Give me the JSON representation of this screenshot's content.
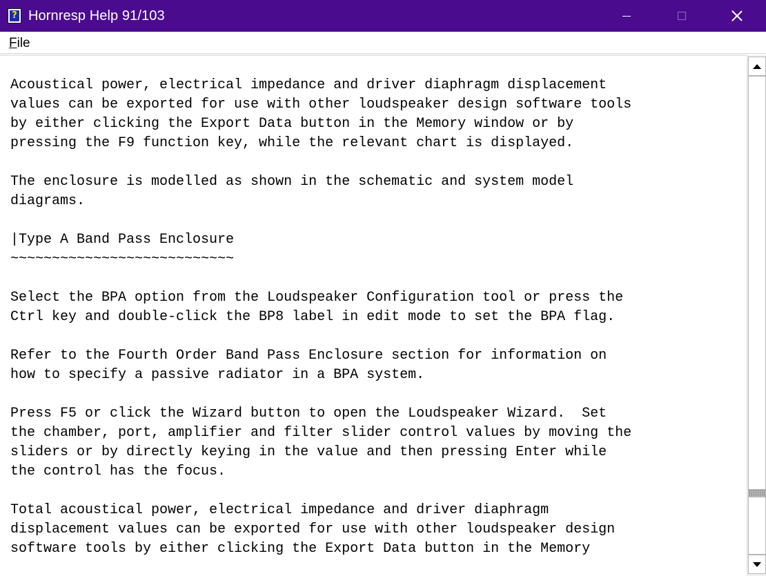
{
  "window": {
    "title": "Hornresp Help   91/103",
    "icon": "help-question-icon",
    "controls": {
      "minimize": "minimize-icon",
      "maximize": "maximize-icon",
      "close": "close-icon"
    }
  },
  "menu": {
    "file_first": "F",
    "file_rest": "ile"
  },
  "content": {
    "lines": [
      "Acoustical power, electrical impedance and driver diaphragm displacement",
      "values can be exported for use with other loudspeaker design software tools",
      "by either clicking the Export Data button in the Memory window or by",
      "pressing the F9 function key, while the relevant chart is displayed.",
      "",
      "The enclosure is modelled as shown in the schematic and system model",
      "diagrams.",
      "",
      "|Type A Band Pass Enclosure",
      "~~~~~~~~~~~~~~~~~~~~~~~~~~~",
      "",
      "Select the BPA option from the Loudspeaker Configuration tool or press the",
      "Ctrl key and double-click the BP8 label in edit mode to set the BPA flag.",
      "",
      "Refer to the Fourth Order Band Pass Enclosure section for information on",
      "how to specify a passive radiator in a BPA system.",
      "",
      "Press F5 or click the Wizard button to open the Loudspeaker Wizard.  Set",
      "the chamber, port, amplifier and filter slider control values by moving the",
      "sliders or by directly keying in the value and then pressing Enter while",
      "the control has the focus.",
      "",
      "Total acoustical power, electrical impedance and driver diaphragm",
      "displacement values can be exported for use with other loudspeaker design",
      "software tools by either clicking the Export Data button in the Memory"
    ]
  },
  "scrollbar": {
    "position_fraction": 0.88
  },
  "colors": {
    "titlebar": "#4b0b8f",
    "text": "#000000",
    "background": "#ffffff"
  }
}
